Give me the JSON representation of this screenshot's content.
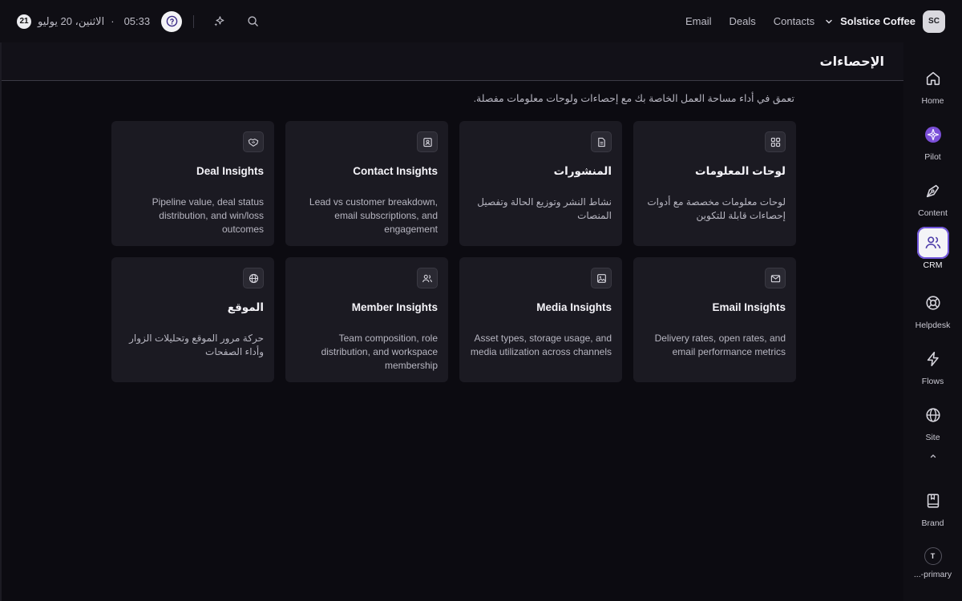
{
  "topbar": {
    "day_badge": "21",
    "date": "الاثنين، 20 يوليو",
    "separator": "·",
    "time": "05:33",
    "nav": [
      "Email",
      "Deals",
      "Contacts"
    ],
    "workspace": "Solstice Coffee",
    "avatar": "SC"
  },
  "page": {
    "title": "الإحصاءات",
    "subtitle": "تعمق في أداء مساحة العمل الخاصة بك مع إحصاءات ولوحات معلومات مفصلة."
  },
  "cards": [
    {
      "title": "لوحات المعلومات",
      "desc": "لوحات معلومات مخصصة مع أدوات إحصاءات قابلة للتكوين",
      "icon": "grid-icon"
    },
    {
      "title": "المنشورات",
      "desc": "نشاط النشر وتوزيع الحالة وتفصيل المنصات",
      "icon": "document-icon"
    },
    {
      "title": "Contact Insights",
      "desc": "Lead vs customer breakdown, email subscriptions, and engagement",
      "icon": "contact-card-icon"
    },
    {
      "title": "Deal Insights",
      "desc": "Pipeline value, deal status distribution, and win/loss outcomes",
      "icon": "handshake-icon"
    },
    {
      "title": "Email Insights",
      "desc": "Delivery rates, open rates, and email performance metrics",
      "icon": "mail-icon"
    },
    {
      "title": "Media Insights",
      "desc": "Asset types, storage usage, and media utilization across channels",
      "icon": "image-icon"
    },
    {
      "title": "Member Insights",
      "desc": "Team composition, role distribution, and workspace membership",
      "icon": "users-icon"
    },
    {
      "title": "الموقع",
      "desc": "حركة مرور الموقع وتحليلات الزوار وأداء الصفحات",
      "icon": "globe-icon"
    }
  ],
  "sidebar": {
    "items": [
      {
        "label": "Home",
        "icon": "home-icon"
      },
      {
        "label": "Pilot",
        "icon": "pilot-icon"
      },
      {
        "label": "Content",
        "icon": "pen-icon"
      },
      {
        "label": "CRM",
        "icon": "users-icon"
      },
      {
        "label": "Helpdesk",
        "icon": "lifebuoy-icon"
      },
      {
        "label": "Flows",
        "icon": "bolt-icon"
      },
      {
        "label": "Site",
        "icon": "globe-icon"
      },
      {
        "label": "Brand",
        "icon": "book-icon"
      }
    ],
    "user_initial": "T",
    "user_label": "...-primary"
  },
  "colors": {
    "accent": "#6f54d9",
    "background": "#0c0b11",
    "card": "#1b1a22"
  }
}
